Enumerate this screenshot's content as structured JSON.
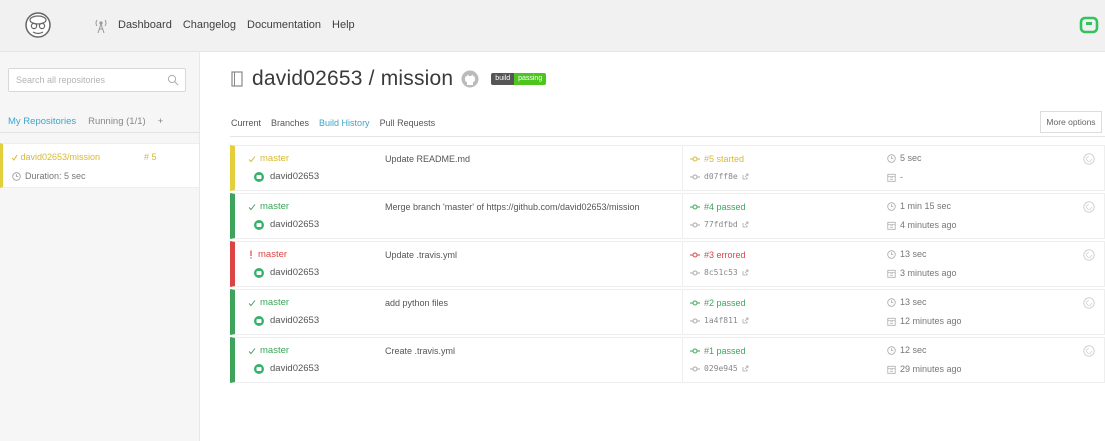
{
  "nav": {
    "items": [
      "Dashboard",
      "Changelog",
      "Documentation",
      "Help"
    ]
  },
  "sidebar": {
    "search_placeholder": "Search all repositories",
    "tabs": {
      "my_repositories": "My Repositories",
      "running": "Running (1/1)",
      "add": "+"
    },
    "repo": {
      "name": "david02653/mission",
      "number": "# 5",
      "duration": "Duration: 5 sec"
    }
  },
  "repo": {
    "title": "david02653 / mission",
    "badge": {
      "left": "build",
      "right": "passing"
    }
  },
  "tabs": [
    "Current",
    "Branches",
    "Build History",
    "Pull Requests"
  ],
  "more_options": "More options",
  "builds": [
    {
      "state": "started",
      "branch": "master",
      "author": "david02653",
      "message": "Update README.md",
      "status": "#5 started",
      "commit": "d07ff8e",
      "duration": "5 sec",
      "time": "-"
    },
    {
      "state": "passed",
      "branch": "master",
      "author": "david02653",
      "message": "Merge branch 'master' of https://github.com/david02653/mission",
      "status": "#4 passed",
      "commit": "77fdfbd",
      "duration": "1 min 15 sec",
      "time": "4 minutes ago"
    },
    {
      "state": "errored",
      "branch": "master",
      "author": "david02653",
      "message": "Update .travis.yml",
      "status": "#3 errored",
      "commit": "8c51c53",
      "duration": "13 sec",
      "time": "3 minutes ago"
    },
    {
      "state": "passed",
      "branch": "master",
      "author": "david02653",
      "message": "add python files",
      "status": "#2 passed",
      "commit": "1a4f811",
      "duration": "13 sec",
      "time": "12 minutes ago"
    },
    {
      "state": "passed",
      "branch": "master",
      "author": "david02653",
      "message": "Create .travis.yml",
      "status": "#1 passed",
      "commit": "029e945",
      "duration": "12 sec",
      "time": "29 minutes ago"
    }
  ],
  "colors": {
    "passed": "#3ea45b",
    "errored": "#db4545",
    "started": "#e2cf3b",
    "accent": "#3ea6c9"
  }
}
